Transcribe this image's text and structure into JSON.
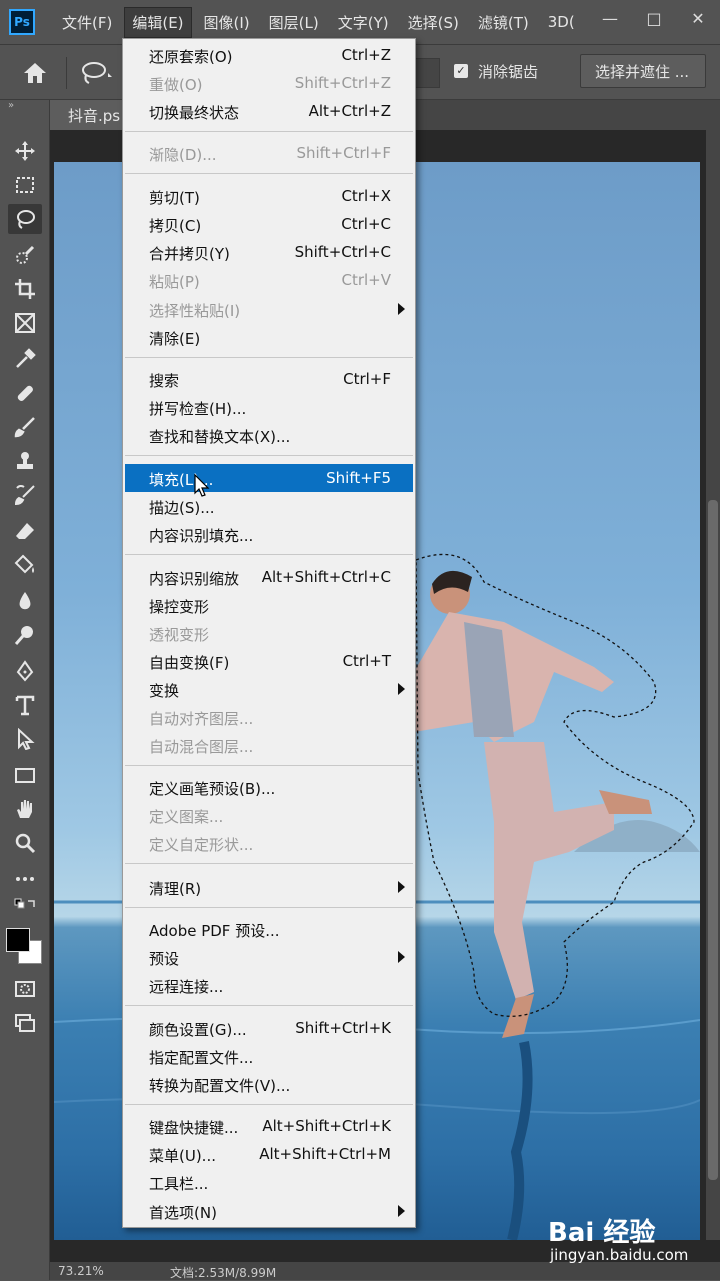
{
  "app": {
    "logo": "Ps"
  },
  "menubar": {
    "items": [
      "文件(F)",
      "编辑(E)",
      "图像(I)",
      "图层(L)",
      "文字(Y)",
      "选择(S)",
      "滤镜(T)",
      "3D("
    ]
  },
  "window_controls": {
    "minimize": "—",
    "maximize": "□",
    "close": "✕"
  },
  "options_bar": {
    "antialias_label": "消除锯齿",
    "antialias_checked": "✓",
    "select_mask_label": "选择并遮住 ..."
  },
  "document": {
    "tab_title": "抖音.ps"
  },
  "statusbar": {
    "zoom": "73.21%",
    "doc_info": "文档:2.53M/8.99M"
  },
  "edit_menu": {
    "items": [
      {
        "label": "还原套索(O)",
        "shortcut": "Ctrl+Z",
        "disabled": false
      },
      {
        "label": "重做(O)",
        "shortcut": "Shift+Ctrl+Z",
        "disabled": true
      },
      {
        "label": "切换最终状态",
        "shortcut": "Alt+Ctrl+Z",
        "disabled": false
      },
      {
        "label": "渐隐(D)...",
        "shortcut": "Shift+Ctrl+F",
        "disabled": true
      },
      {
        "label": "剪切(T)",
        "shortcut": "Ctrl+X",
        "disabled": false
      },
      {
        "label": "拷贝(C)",
        "shortcut": "Ctrl+C",
        "disabled": false
      },
      {
        "label": "合并拷贝(Y)",
        "shortcut": "Shift+Ctrl+C",
        "disabled": false
      },
      {
        "label": "粘贴(P)",
        "shortcut": "Ctrl+V",
        "disabled": true
      },
      {
        "label": "选择性粘贴(I)",
        "shortcut": "",
        "disabled": true
      },
      {
        "label": "清除(E)",
        "shortcut": "",
        "disabled": false
      },
      {
        "label": "搜索",
        "shortcut": "Ctrl+F",
        "disabled": false
      },
      {
        "label": "拼写检查(H)...",
        "shortcut": "",
        "disabled": false
      },
      {
        "label": "查找和替换文本(X)...",
        "shortcut": "",
        "disabled": false
      },
      {
        "label": "填充(L)...",
        "shortcut": "Shift+F5",
        "disabled": false,
        "highlighted": true
      },
      {
        "label": "描边(S)...",
        "shortcut": "",
        "disabled": false
      },
      {
        "label": "内容识别填充...",
        "shortcut": "",
        "disabled": false
      },
      {
        "label": "内容识别缩放",
        "shortcut": "Alt+Shift+Ctrl+C",
        "disabled": false
      },
      {
        "label": "操控变形",
        "shortcut": "",
        "disabled": false
      },
      {
        "label": "透视变形",
        "shortcut": "",
        "disabled": true
      },
      {
        "label": "自由变换(F)",
        "shortcut": "Ctrl+T",
        "disabled": false
      },
      {
        "label": "变换",
        "shortcut": "",
        "disabled": false
      },
      {
        "label": "自动对齐图层...",
        "shortcut": "",
        "disabled": true
      },
      {
        "label": "自动混合图层...",
        "shortcut": "",
        "disabled": true
      },
      {
        "label": "定义画笔预设(B)...",
        "shortcut": "",
        "disabled": false
      },
      {
        "label": "定义图案...",
        "shortcut": "",
        "disabled": true
      },
      {
        "label": "定义自定形状...",
        "shortcut": "",
        "disabled": true
      },
      {
        "label": "清理(R)",
        "shortcut": "",
        "disabled": false
      },
      {
        "label": "Adobe PDF 预设...",
        "shortcut": "",
        "disabled": false
      },
      {
        "label": "预设",
        "shortcut": "",
        "disabled": false
      },
      {
        "label": "远程连接...",
        "shortcut": "",
        "disabled": false
      },
      {
        "label": "颜色设置(G)...",
        "shortcut": "Shift+Ctrl+K",
        "disabled": false
      },
      {
        "label": "指定配置文件...",
        "shortcut": "",
        "disabled": false
      },
      {
        "label": "转换为配置文件(V)...",
        "shortcut": "",
        "disabled": false
      },
      {
        "label": "键盘快捷键...",
        "shortcut": "Alt+Shift+Ctrl+K",
        "disabled": false
      },
      {
        "label": "菜单(U)...",
        "shortcut": "Alt+Shift+Ctrl+M",
        "disabled": false
      },
      {
        "label": "工具栏...",
        "shortcut": "",
        "disabled": false
      },
      {
        "label": "首选项(N)",
        "shortcut": "",
        "disabled": false
      }
    ]
  },
  "watermark": {
    "logo": "Bai 经验",
    "url": "jingyan.baidu.com"
  },
  "colors": {
    "highlight": "#0a70c2",
    "menu_bg": "#f0f0f0",
    "chrome": "#535353"
  }
}
